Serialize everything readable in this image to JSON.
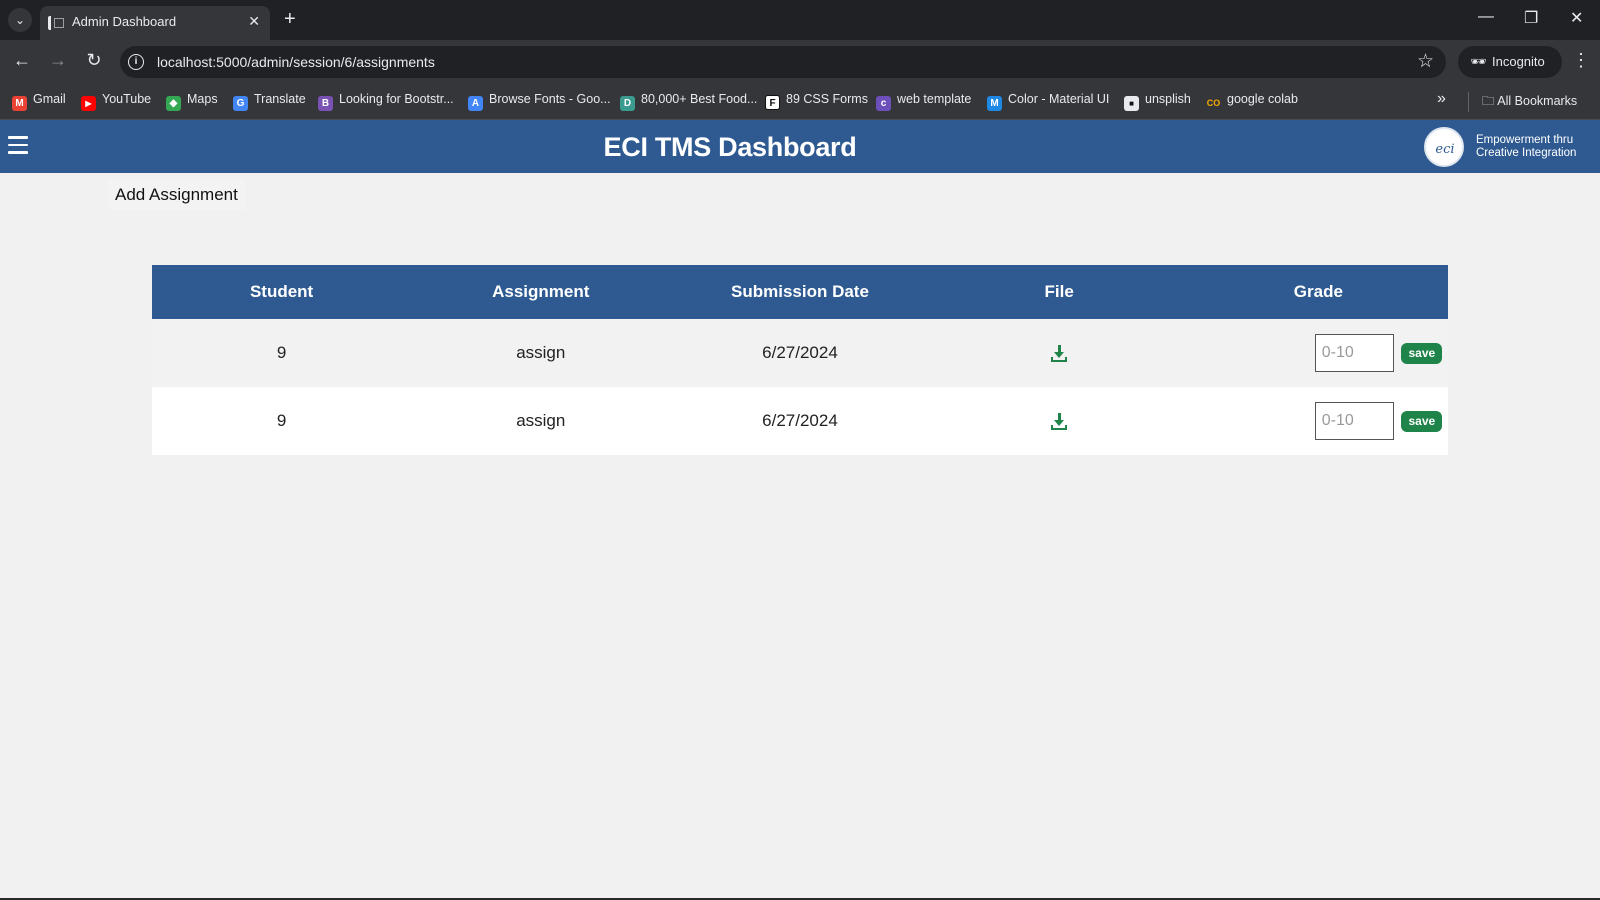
{
  "browser": {
    "tab_title": "Admin Dashboard",
    "tab_close": "✕",
    "new_tab": "+",
    "url": "localhost:5000/admin/session/6/assignments",
    "incognito_label": "Incognito",
    "bookmarks": [
      {
        "label": "Gmail",
        "icon": "gmail-icon",
        "color": "#ea4335",
        "glyph": "M"
      },
      {
        "label": "YouTube",
        "icon": "youtube-icon",
        "color": "#ff0000",
        "glyph": "▶"
      },
      {
        "label": "Maps",
        "icon": "maps-icon",
        "color": "#34a853",
        "glyph": "◆"
      },
      {
        "label": "Translate",
        "icon": "translate-icon",
        "color": "#4285f4",
        "glyph": "G"
      },
      {
        "label": "Looking for Bootstr...",
        "icon": "bootstrap-icon",
        "color": "#7952b3",
        "glyph": "B"
      },
      {
        "label": "Browse Fonts - Goo...",
        "icon": "google-fonts-icon",
        "color": "#4285f4",
        "glyph": "A"
      },
      {
        "label": "80,000+ Best Food...",
        "icon": "dribbble-d-icon",
        "color": "#3a9b8e",
        "glyph": "D"
      },
      {
        "label": "89 CSS Forms",
        "icon": "f-logo-icon",
        "color": "#111111",
        "glyph": "F"
      },
      {
        "label": "web template",
        "icon": "colorlib-icon",
        "color": "#6c4fbb",
        "glyph": "c"
      },
      {
        "label": "Color - Material UI",
        "icon": "mui-icon",
        "color": "#1e88e5",
        "glyph": "M"
      },
      {
        "label": "unsplish",
        "icon": "unsplash-icon",
        "color": "#111111",
        "glyph": "■"
      },
      {
        "label": "google colab",
        "icon": "colab-icon",
        "color": "#f9ab00",
        "glyph": "CO"
      }
    ],
    "all_bookmarks": "All Bookmarks"
  },
  "header": {
    "title": "ECI TMS Dashboard",
    "logo_text": "eci",
    "tagline_line1": "Empowerment thru",
    "tagline_line2": "Creative Integration"
  },
  "main": {
    "add_assignment_label": "Add Assignment",
    "table": {
      "headers": [
        "Student",
        "Assignment",
        "Submission Date",
        "File",
        "Grade"
      ],
      "rows": [
        {
          "student": "9",
          "assignment": "assign",
          "date": "6/27/2024",
          "grade_placeholder": "0-10",
          "save_label": "save"
        },
        {
          "student": "9",
          "assignment": "assign",
          "date": "6/27/2024",
          "grade_placeholder": "0-10",
          "save_label": "save"
        }
      ]
    }
  },
  "colors": {
    "brand_blue": "#2e5a91",
    "save_green": "#1e8449"
  }
}
